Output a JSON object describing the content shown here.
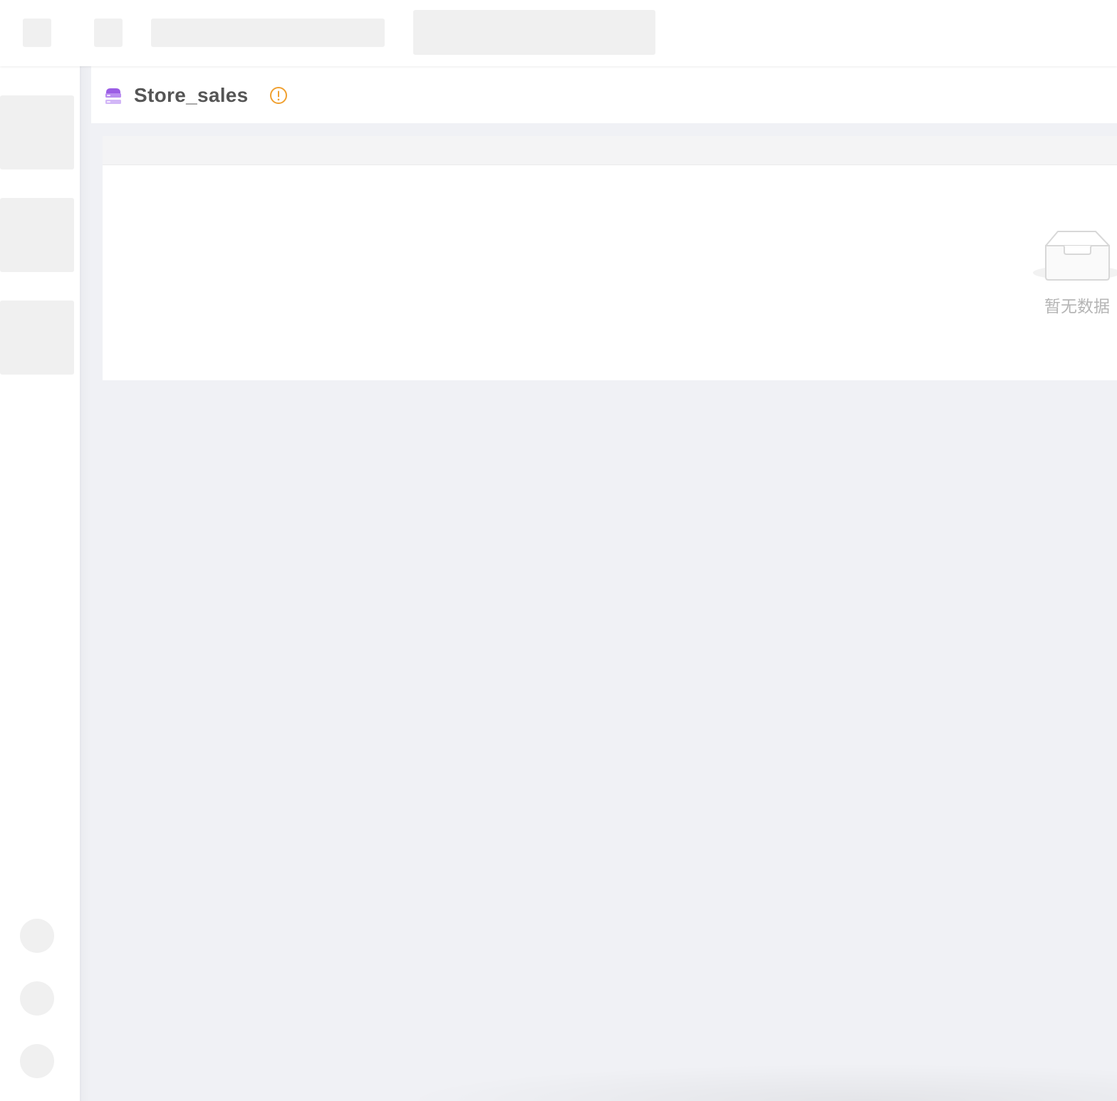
{
  "header": {
    "loading_placeholders": [
      "logo-placeholder",
      "nav-placeholder",
      "breadcrumb-placeholder",
      "search-placeholder"
    ]
  },
  "sidebar": {
    "loading_items": 3,
    "loading_avatars": 3
  },
  "page": {
    "title": "Store_sales",
    "title_icon": "database-icon",
    "status_icon": "warning-icon",
    "status_color": "#f0a030",
    "icon_accent": "#9b5de5"
  },
  "table": {
    "empty_text": "暂无数据",
    "empty_icon": "empty-inbox-icon"
  }
}
